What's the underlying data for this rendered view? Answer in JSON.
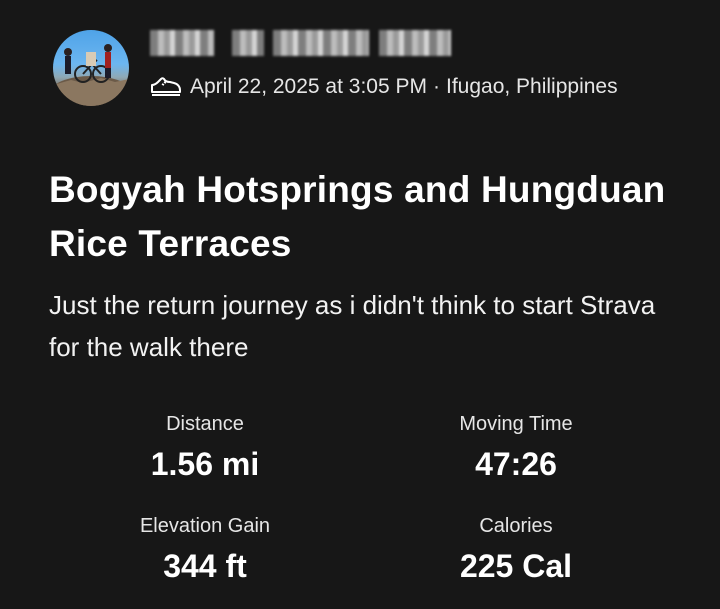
{
  "activity": {
    "athlete_name_blurred": "",
    "date": "April 22, 2025 at 3:05 PM",
    "separator": "·",
    "location": "Ifugao, Philippines",
    "type_icon": "shoe-icon",
    "title": "Bogyah Hotsprings and Hungduan Rice Terraces",
    "description": "Just the return journey as i didn't think to start Strava for the walk there"
  },
  "stats": [
    {
      "label": "Distance",
      "value": "1.56 mi"
    },
    {
      "label": "Moving Time",
      "value": "47:26"
    },
    {
      "label": "Elevation Gain",
      "value": "344 ft"
    },
    {
      "label": "Calories",
      "value": "225 Cal"
    }
  ],
  "colors": {
    "background": "#171717",
    "text": "#ffffff",
    "secondary_text": "#e6e6e6"
  }
}
